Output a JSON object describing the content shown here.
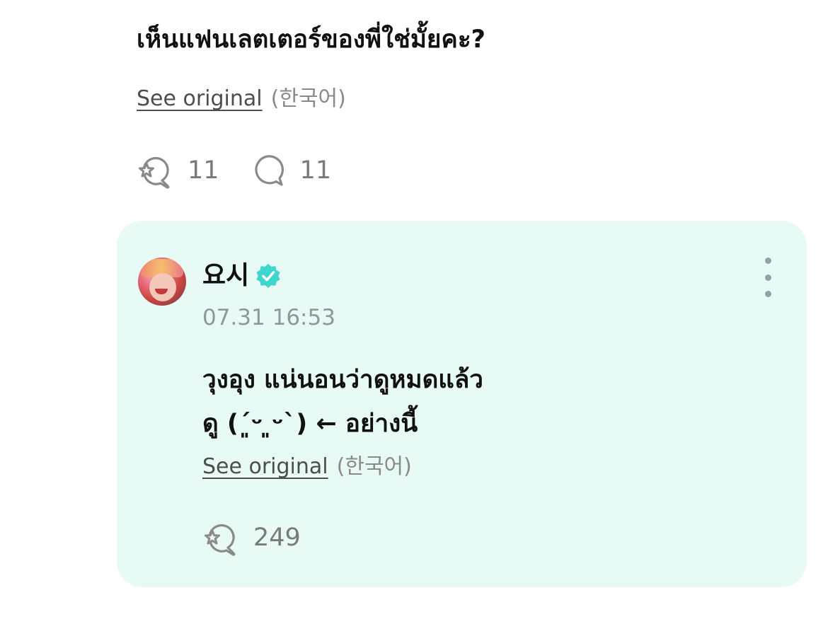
{
  "post": {
    "text": "เห็นแฟนเลตเตอร์ของพี่ใช่มั้ยคะ?",
    "see_original": "See original",
    "language": "(한국어)",
    "sparkle_count": "11",
    "comment_count": "11"
  },
  "reply": {
    "author": "요시",
    "timestamp": "07.31 16:53",
    "lines": [
      "วุงอุง แน่นอนว่าดูหมดแล้ว",
      "ดู (´͈ᵕ ͈ᵕ`) ← อย่างนี้"
    ],
    "see_original": "See original",
    "language": "(한국어)",
    "sparkle_count": "249"
  },
  "colors": {
    "card_background": "#e7faf6",
    "verified_badge": "#3fd6cf",
    "muted_text": "#8a8a8a",
    "timestamp_text": "#8d9a97",
    "icon_gray": "#8a8a8a"
  },
  "icons": {
    "reaction": "sparkle-bubble-icon",
    "comment": "comment-bubble-icon",
    "verified": "verified-badge-icon",
    "more": "more-vertical-icon"
  }
}
